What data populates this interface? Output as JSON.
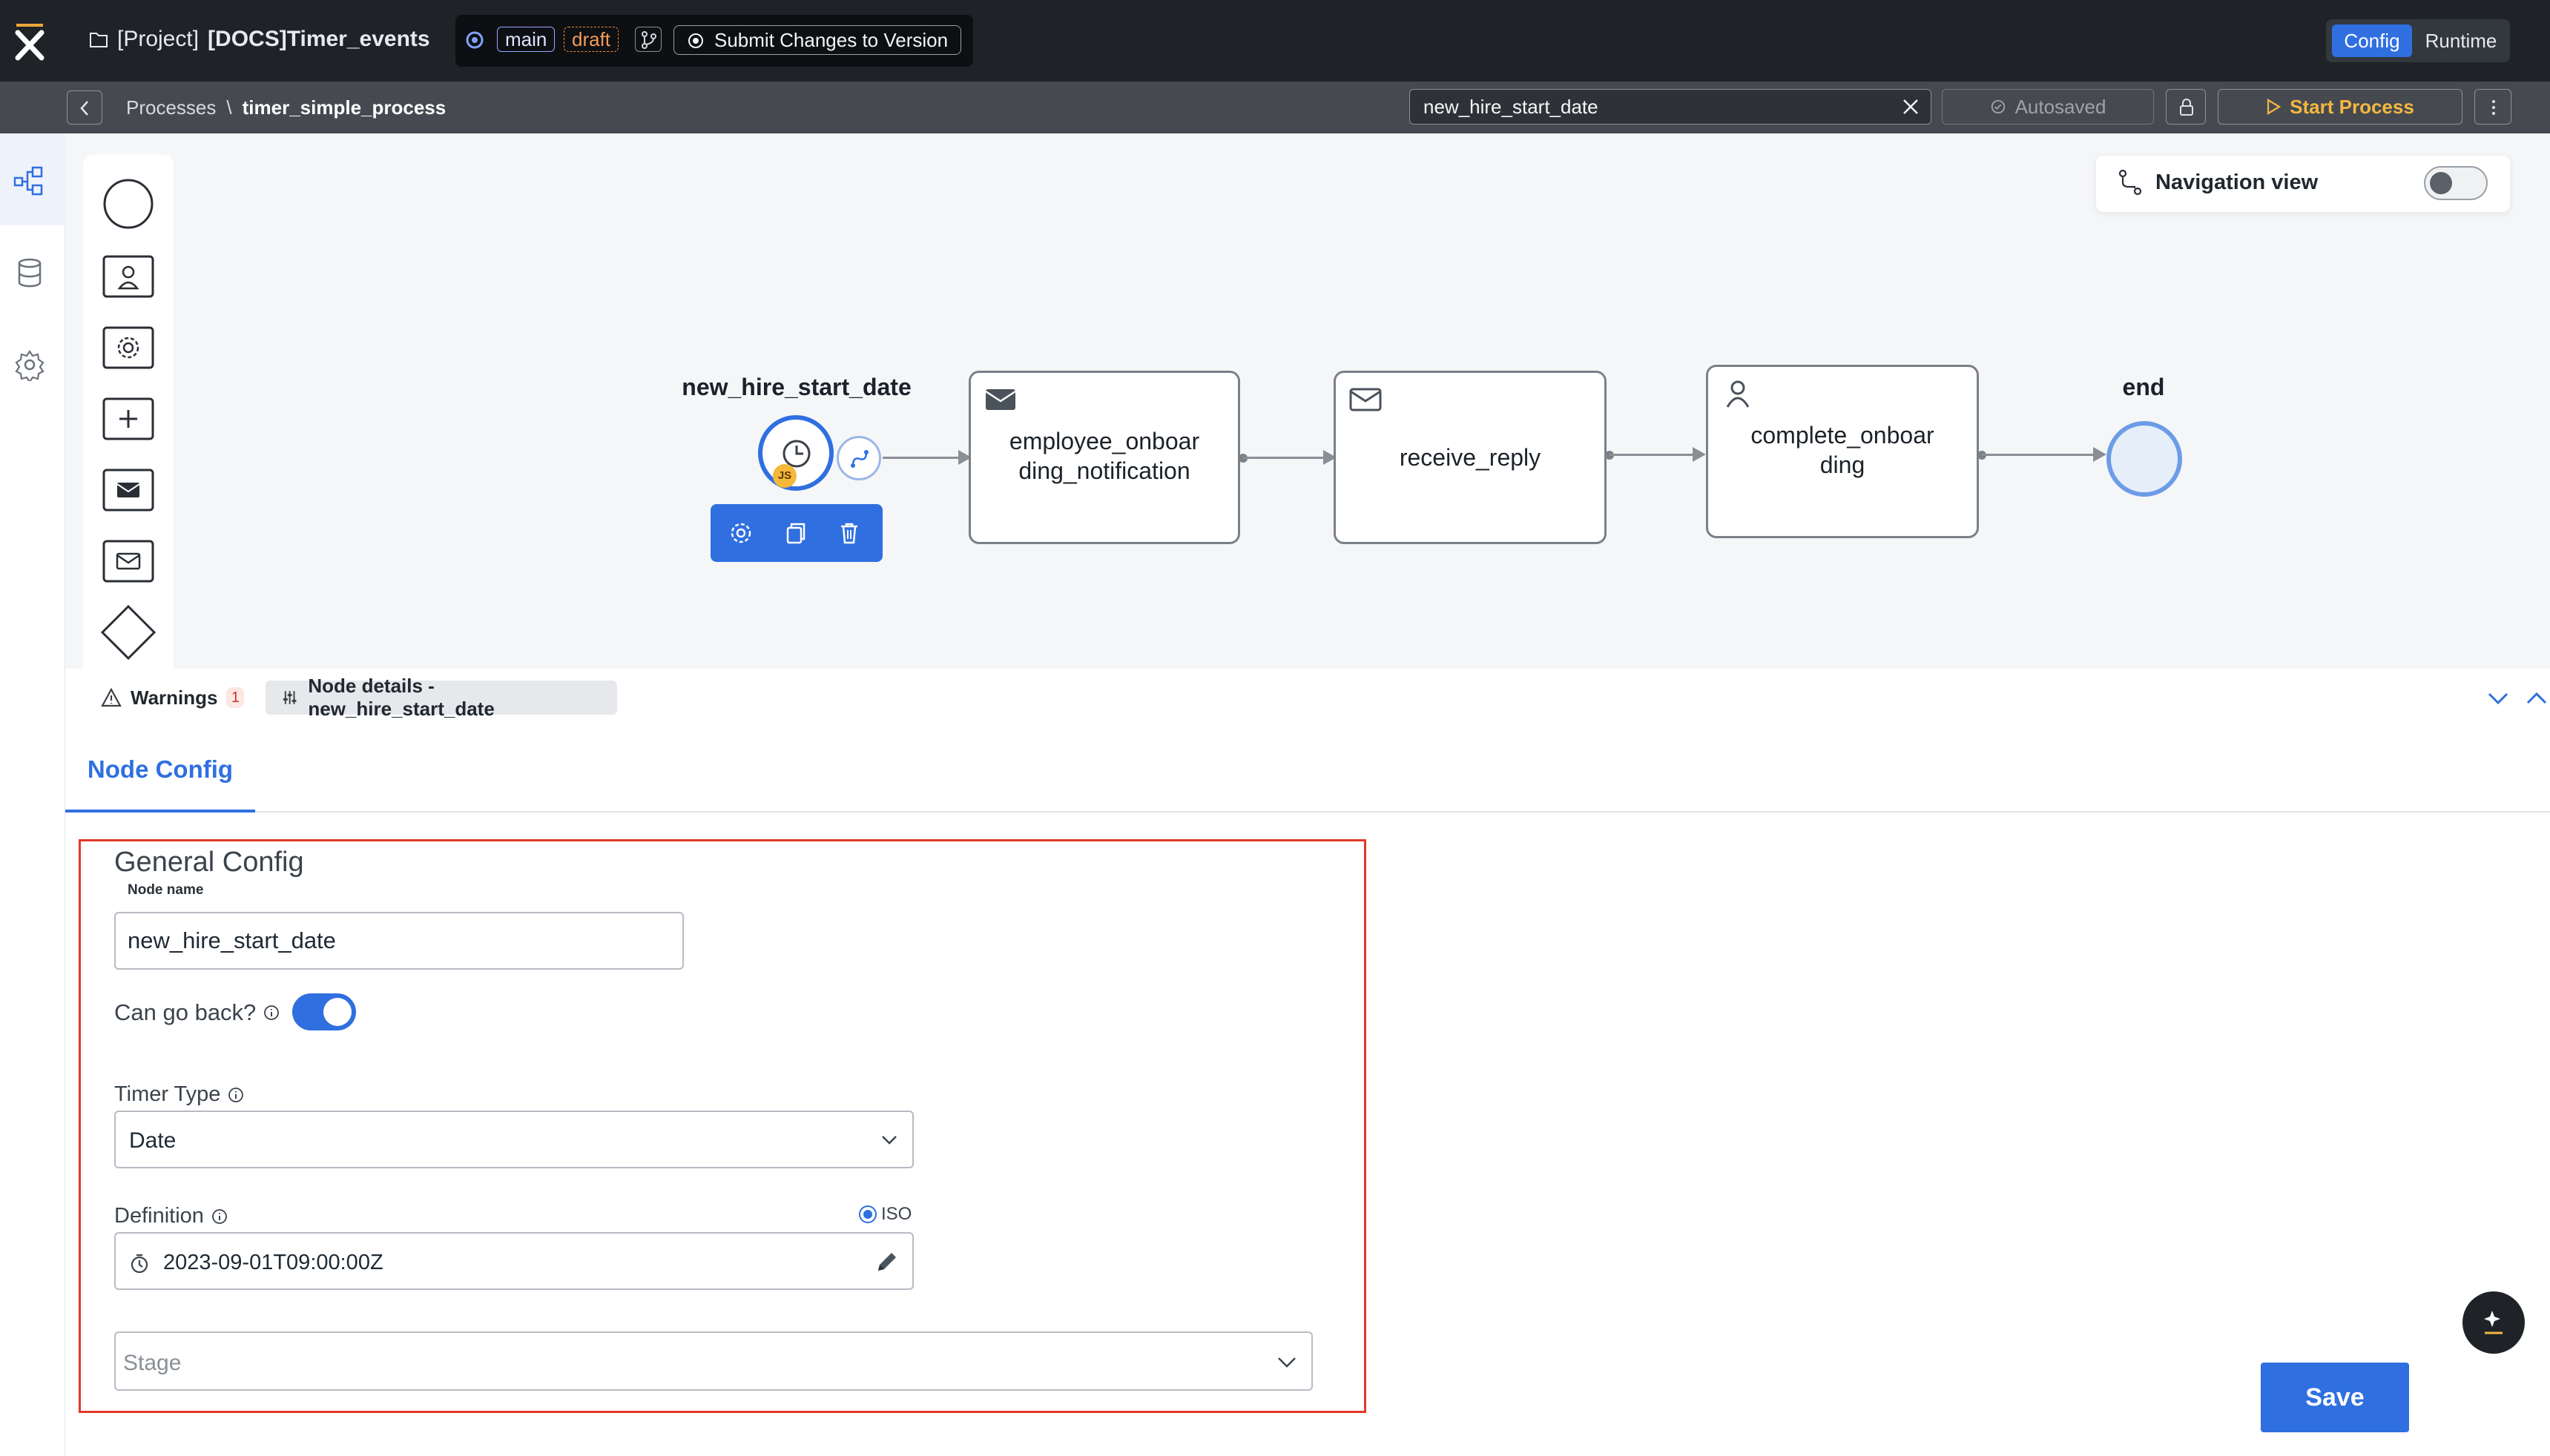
{
  "topbar": {
    "project_prefix": "[Project]",
    "project_name": "[DOCS]Timer_events",
    "branch": "main",
    "status": "draft",
    "submit_label": "Submit Changes to Version",
    "mode_config": "Config",
    "mode_runtime": "Runtime",
    "accent": "#2f6fe0"
  },
  "subbar": {
    "breadcrumb_root": "Processes",
    "breadcrumb_sep": "\\",
    "breadcrumb_current": "timer_simple_process",
    "search_value": "new_hire_start_date",
    "autosaved_label": "Autosaved",
    "start_label": "Start Process"
  },
  "canvas": {
    "navigation_view_label": "Navigation view",
    "navigation_view_on": false,
    "start_node_label": "new_hire_start_date",
    "start_node_badge": "JS",
    "tasks": [
      {
        "line1": "employee_onboar",
        "line2": "ding_notification",
        "icon": "envelope-filled-icon"
      },
      {
        "line1": "receive_reply",
        "line2": "",
        "icon": "envelope-outline-icon"
      },
      {
        "line1": "complete_onboar",
        "line2": "ding",
        "icon": "user-icon"
      }
    ],
    "end_node_label": "end"
  },
  "panel": {
    "warnings_label": "Warnings",
    "warnings_count": "1",
    "node_details_label": "Node details - new_hire_start_date",
    "subtab_label": "Node Config"
  },
  "form": {
    "section_title": "General Config",
    "node_name_label": "Node name",
    "node_name_value": "new_hire_start_date",
    "can_go_back_label": "Can go back?",
    "can_go_back_on": true,
    "timer_type_label": "Timer Type",
    "timer_type_value": "Date",
    "definition_label": "Definition",
    "iso_label": "ISO",
    "definition_value": "2023-09-01T09:00:00Z",
    "stage_placeholder": "Stage",
    "save_label": "Save"
  }
}
